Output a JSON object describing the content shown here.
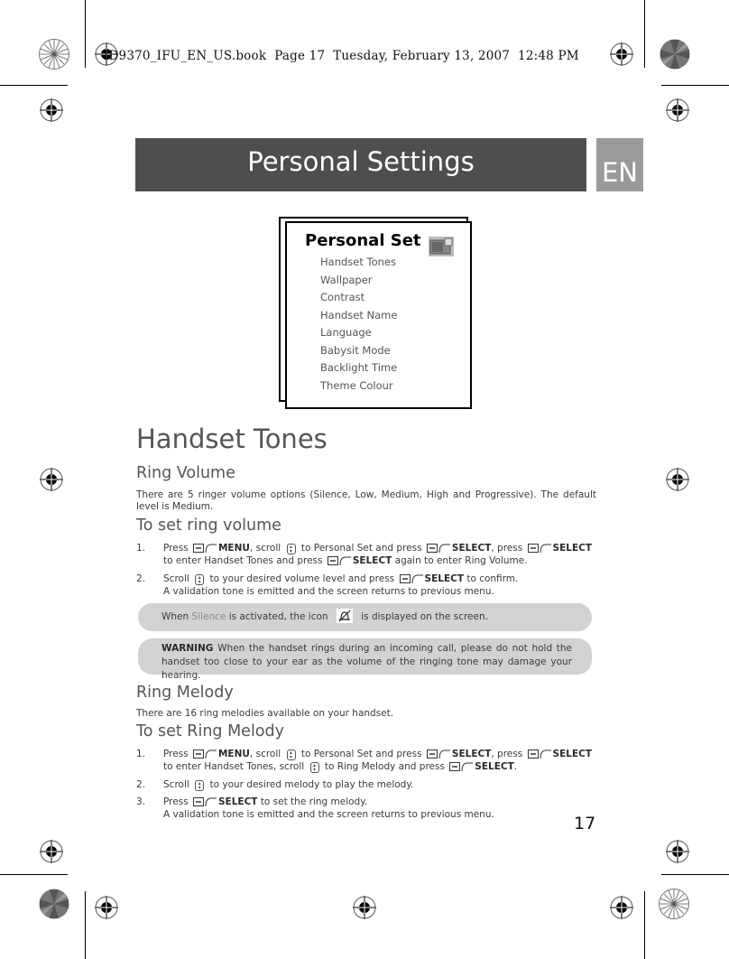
{
  "book_header": "ID9370_IFU_EN_US.book  Page 17  Tuesday, February 13, 2007  12:48 PM",
  "page_title": "Personal Settings",
  "language_tab": "EN",
  "menu_screen": {
    "title": "Personal Set",
    "icon": "personal-settings-icon",
    "items": [
      "Handset Tones",
      "Wallpaper",
      "Contrast",
      "Handset Name",
      "Language",
      "Babysit Mode",
      "Backlight Time",
      "Theme Colour"
    ]
  },
  "section_title": "Handset Tones",
  "ring_volume": {
    "heading": "Ring Volume",
    "description": "There are 5 ringer volume options (Silence, Low, Medium, High and Progressive). The default level is Medium.",
    "howto_heading": "To set ring volume",
    "steps": [
      {
        "num": "1.",
        "parts": {
          "a": "Press",
          "b": "MENU",
          "c": ", scroll",
          "d": "to Personal Set and press",
          "e": "SELECT",
          "f": ", press",
          "g": "SELECT",
          "h": "to enter Handset Tones and press",
          "i": "SELECT",
          "j": "again to enter Ring Volume."
        }
      },
      {
        "num": "2.",
        "parts": {
          "a": "Scroll",
          "b": "to your desired volume level and press",
          "c": "SELECT",
          "d": "to confirm.",
          "e": "A validation tone is emitted and the screen returns to previous menu."
        }
      }
    ]
  },
  "notes": {
    "silence": {
      "prefix": "When",
      "highlight": "Silence",
      "middle": "is activated, the icon",
      "suffix": "is displayed on the screen.",
      "icon": "silence-bell-icon"
    },
    "warning": {
      "label": "WARNING",
      "text": "When the handset rings during an incoming call, please do not hold the handset too close to your ear as the volume of the ringing tone may damage your hearing."
    }
  },
  "ring_melody": {
    "heading": "Ring Melody",
    "description": "There are 16 ring melodies available on your handset.",
    "howto_heading": "To set Ring Melody",
    "steps": [
      {
        "num": "1.",
        "parts": {
          "a": "Press",
          "b": "MENU",
          "c": ", scroll",
          "d": "to Personal Set and press",
          "e": "SELECT",
          "f": ", press",
          "g": "SELECT",
          "h": "to enter Handset Tones, scroll",
          "i": "to Ring Melody and press",
          "j": "SELECT",
          "k": "."
        }
      },
      {
        "num": "2.",
        "parts": {
          "a": "Scroll",
          "b": "to your desired melody to play the melody."
        }
      },
      {
        "num": "3.",
        "parts": {
          "a": "Press",
          "b": "SELECT",
          "c": "to set the ring melody.",
          "d": "A validation tone is emitted and the screen returns to previous menu."
        }
      }
    ]
  },
  "page_number": "17",
  "icons": {
    "softkey": "left-softkey-icon",
    "scroll": "scroll-updown-icon"
  }
}
